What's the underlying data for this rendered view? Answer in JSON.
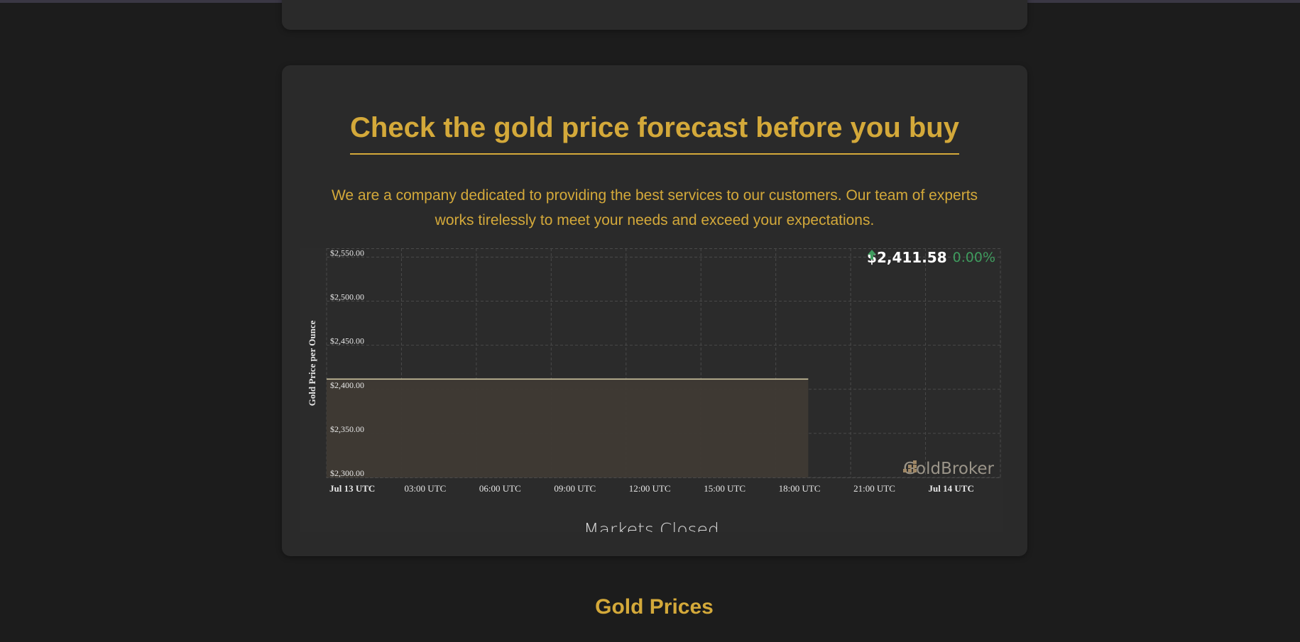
{
  "section": {
    "title": "Check the gold price forecast before you buy",
    "description": "We are a company dedicated to providing the best services to our customers. Our team of experts works tirelessly to meet your needs and exceed your expectations."
  },
  "widget": {
    "price": "$2,411.58",
    "change": "0.00%",
    "change_direction": "up",
    "brand": "GoldBroker",
    "status": "Markets Closed"
  },
  "chart_data": {
    "type": "area",
    "ylabel": "Gold Price per Ounce",
    "ylim": [
      2300,
      2560
    ],
    "y_ticks": [
      2300,
      2350,
      2400,
      2450,
      2500,
      2550
    ],
    "y_tick_labels": [
      "$2,300.00",
      "$2,350.00",
      "$2,400.00",
      "$2,450.00",
      "$2,500.00",
      "$2,550.00"
    ],
    "x_ticks": [
      0,
      3,
      6,
      9,
      12,
      15,
      18,
      21,
      24
    ],
    "x_tick_labels": [
      "Jul 13 UTC",
      "03:00 UTC",
      "06:00 UTC",
      "09:00 UTC",
      "12:00 UTC",
      "15:00 UTC",
      "18:00 UTC",
      "21:00 UTC",
      "Jul 14 UTC"
    ],
    "x_tick_bold": [
      true,
      false,
      false,
      false,
      false,
      false,
      false,
      false,
      true
    ],
    "xlim": [
      0,
      27
    ],
    "series": [
      {
        "x": [
          0,
          19.3
        ],
        "values": [
          2411.58,
          2411.58
        ]
      }
    ],
    "grid": true,
    "colors": {
      "line": "#d9cfa8",
      "fill": "#3f3a34",
      "grid": "#4a4a4a",
      "tick": "#e6e6e6"
    }
  },
  "gold_prices": {
    "title": "Gold Prices"
  }
}
